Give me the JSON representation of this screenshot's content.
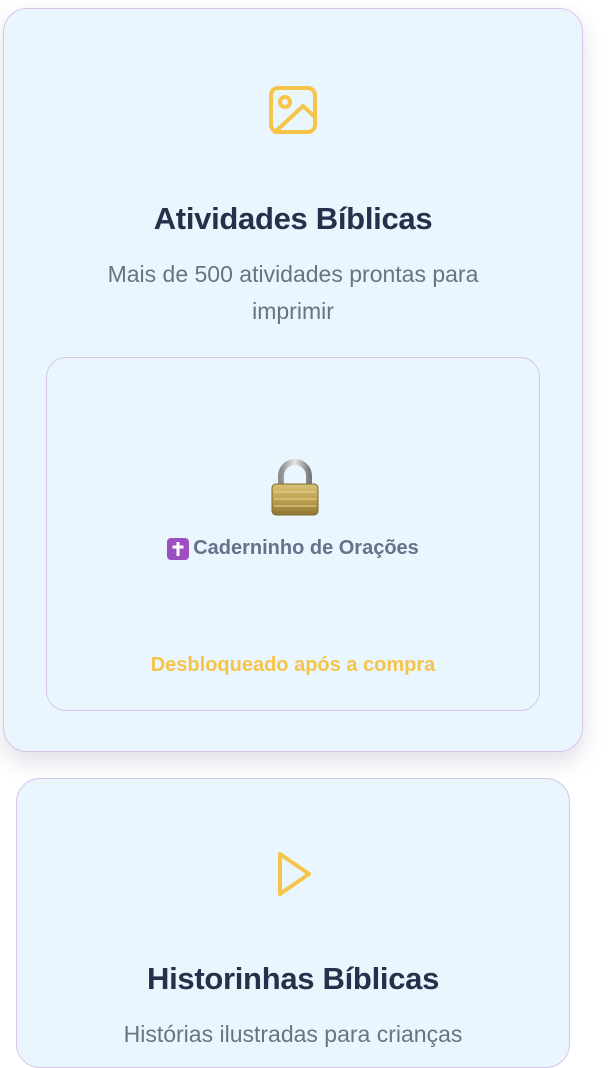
{
  "cards": [
    {
      "icon": "image-icon",
      "title": "Atividades Bíblicas",
      "description": "Mais de 500 atividades prontas para imprimir",
      "locked_item": {
        "icon": "padlock-icon",
        "badge_icon": "latin-cross-icon",
        "label": "Caderninho de Orações",
        "unlock_note": "Desbloqueado após a compra"
      }
    },
    {
      "icon": "play-icon",
      "title": "Historinhas Bíblicas",
      "description": "Histórias ilustradas para crianças"
    }
  ],
  "colors": {
    "card_background": "#e9f6fd",
    "card_border": "#d7c5ec",
    "accent_yellow": "#f7c44a",
    "title_text": "#25304a",
    "body_text": "#677486",
    "badge_purple": "#9b4fc2"
  }
}
